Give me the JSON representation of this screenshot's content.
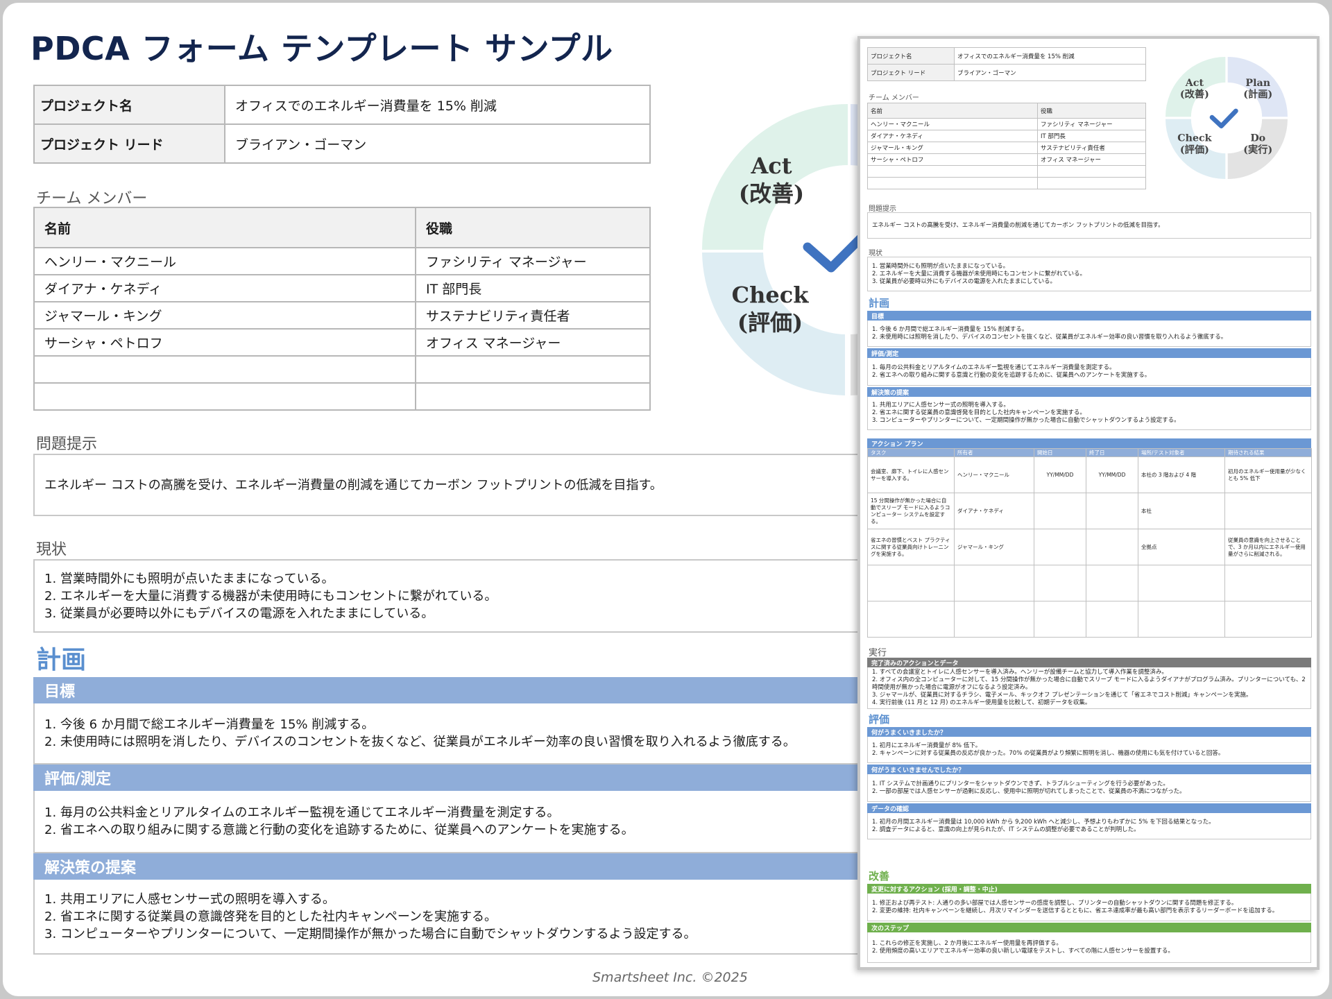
{
  "title": "PDCA フォーム テンプレート サンプル",
  "project": {
    "name_label": "プロジェクト名",
    "name_value": "オフィスでのエネルギー消費量を 15% 削減",
    "lead_label": "プロジェクト リード",
    "lead_value": "ブライアン・ゴーマン"
  },
  "team": {
    "heading": "チーム メンバー",
    "col_name": "名前",
    "col_role": "役職",
    "rows": [
      {
        "name": "ヘンリー・マクニール",
        "role": "ファシリティ マネージャー"
      },
      {
        "name": "ダイアナ・ケネディ",
        "role": "IT 部門長"
      },
      {
        "name": "ジャマール・キング",
        "role": "サステナビリティ責任者"
      },
      {
        "name": "サーシャ・ペトロフ",
        "role": "オフィス マネージャー"
      },
      {
        "name": "",
        "role": ""
      },
      {
        "name": "",
        "role": ""
      }
    ]
  },
  "problem": {
    "heading": "問題提示",
    "text": "エネルギー コストの高騰を受け、エネルギー消費量の削減を通じてカーボン フットプリントの低減を目指す。"
  },
  "current": {
    "heading": "現状",
    "items": [
      "1. 営業時間外にも照明が点いたままになっている。",
      "2. エネルギーを大量に消費する機器が未使用時にもコンセントに繋がれている。",
      "3. 従業員が必要時以外にもデバイスの電源を入れたままにしている。"
    ]
  },
  "plan": {
    "heading": "計画",
    "goal_bar": "目標",
    "goal_items": [
      "1. 今後 6 か月間で総エネルギー消費量を 15% 削減する。",
      "2. 未使用時には照明を消したり、デバイスのコンセントを抜くなど、従業員がエネルギー効率の良い習慣を取り入れるよう徹底する。"
    ],
    "measure_bar": "評価/測定",
    "measure_items": [
      "1. 毎月の公共料金とリアルタイムのエネルギー監視を通じてエネルギー消費量を測定する。",
      "2. 省エネへの取り組みに関する意識と行動の変化を追跡するために、従業員へのアンケートを実施する。"
    ],
    "solution_bar": "解決策の提案",
    "solution_items": [
      "1. 共用エリアに人感センサー式の照明を導入する。",
      "2. 省エネに関する従業員の意識啓発を目的とした社内キャンペーンを実施する。",
      "3. コンピューターやプリンターについて、一定期間操作が無かった場合に自動でシャットダウンするよう設定する。"
    ]
  },
  "wheel": {
    "act": "Act",
    "act_jp": "(改善)",
    "plan": "Plan",
    "plan_jp": "(計画)",
    "check": "Check",
    "check_jp": "(評価)",
    "do": "Do",
    "do_jp": "(実行)",
    "colors": {
      "act": "#dff2ea",
      "plan": "#dfe6f5",
      "check": "#deedf3",
      "do": "#e3e3e3",
      "check_mark": "#3f73c0"
    }
  },
  "mini": {
    "action_plan": {
      "bar": "アクション プラン",
      "headers": [
        "タスク",
        "所有者",
        "開始日",
        "終了日",
        "場所/テスト対象者",
        "期待される結果"
      ],
      "rows": [
        [
          "会議室、廊下、トイレに人感センサーを導入する。",
          "ヘンリー・マクニール",
          "YY/MM/DD",
          "YY/MM/DD",
          "本社の 3 階および 4 階",
          "初月のエネルギー使用量が少なくとも 5% 低下"
        ],
        [
          "15 分間操作が無かった場合に自動でスリープ モードに入るようコンピューター システムを設定する。",
          "ダイアナ・ケネディ",
          "",
          "",
          "本社",
          ""
        ],
        [
          "省エネの習慣とベスト プラクティスに関する従業員向けトレーニングを実施する。",
          "ジャマール・キング",
          "",
          "",
          "全拠点",
          "従業員の意識を向上させることで、3 か月以内にエネルギー使用量がさらに削減される。"
        ],
        [
          "",
          "",
          "",
          "",
          "",
          ""
        ],
        [
          "",
          "",
          "",
          "",
          "",
          ""
        ]
      ]
    },
    "do": {
      "heading": "実行",
      "bar": "完了済みのアクションとデータ",
      "items": [
        "1. すべての会議室とトイレに人感センサーを導入済み。ヘンリーが設備チームと協力して導入作業を調整済み。",
        "2. オフィス内の全コンピューターに対して、15 分間操作が無かった場合に自動でスリープ モードに入るようダイアナがプログラム済み。プリンターについても、2 時間使用が無かった場合に電源がオフになるよう設定済み。",
        "3. ジャマールが、従業員に対するチラシ、電子メール、キックオフ プレゼンテーションを通じて「省エネでコスト削減」キャンペーンを実施。",
        "4. 実行前後 (11 月と 12 月) のエネルギー使用量を比較して、初期データを収集。"
      ]
    },
    "check": {
      "heading": "評価",
      "well_bar": "何がうまくいきましたか？",
      "well_items": [
        "1. 初月にエネルギー消費量が 8% 低下。",
        "2. キャンペーンに対する従業員の反応が良かった。70% の従業員がより頻繁に照明を消し、機器の使用にも気を付けていると回答。"
      ],
      "notwell_bar": "何がうまくいきませんでしたか？",
      "notwell_items": [
        "1. IT システムで計画通りにプリンターをシャットダウンできず、トラブルシューティングを行う必要があった。",
        "2. 一部の部屋では人感センサーが過剰に反応し、使用中に照明が切れてしまったことで、従業員の不満につながった。"
      ],
      "data_bar": "データの確認",
      "data_items": [
        "1. 初月の月間エネルギー消費量は 10,000 kWh から 9,200 kWh へと減少し、予想よりもわずかに 5% を下回る結果となった。",
        "2. 調査データによると、意識の向上が見られたが、IT システムの調整が必要であることが判明した。"
      ]
    },
    "act": {
      "heading": "改善",
      "changes_bar": "変更に対するアクション (採用・調整・中止)",
      "changes_items": [
        "1. 修正および再テスト: 人通りの多い部屋では人感センサーの感度を調整し、プリンターの自動シャットダウンに関する問題を修正する。",
        "2. 変更の維持: 社内キャンペーンを継続し、月次リマインダーを送信するとともに、省エネ達成率が最も高い部門を表示するリーダーボードを追加する。"
      ],
      "next_bar": "次のステップ",
      "next_items": [
        "1. これらの修正を実施し、2 か月後にエネルギー使用量を再評価する。",
        "2. 使用頻度の高いエリアでエネルギー効率の良い新しい電球をテストし、すべての階に人感センサーを設置する。"
      ]
    }
  },
  "footer": "Smartsheet Inc. ©2025"
}
